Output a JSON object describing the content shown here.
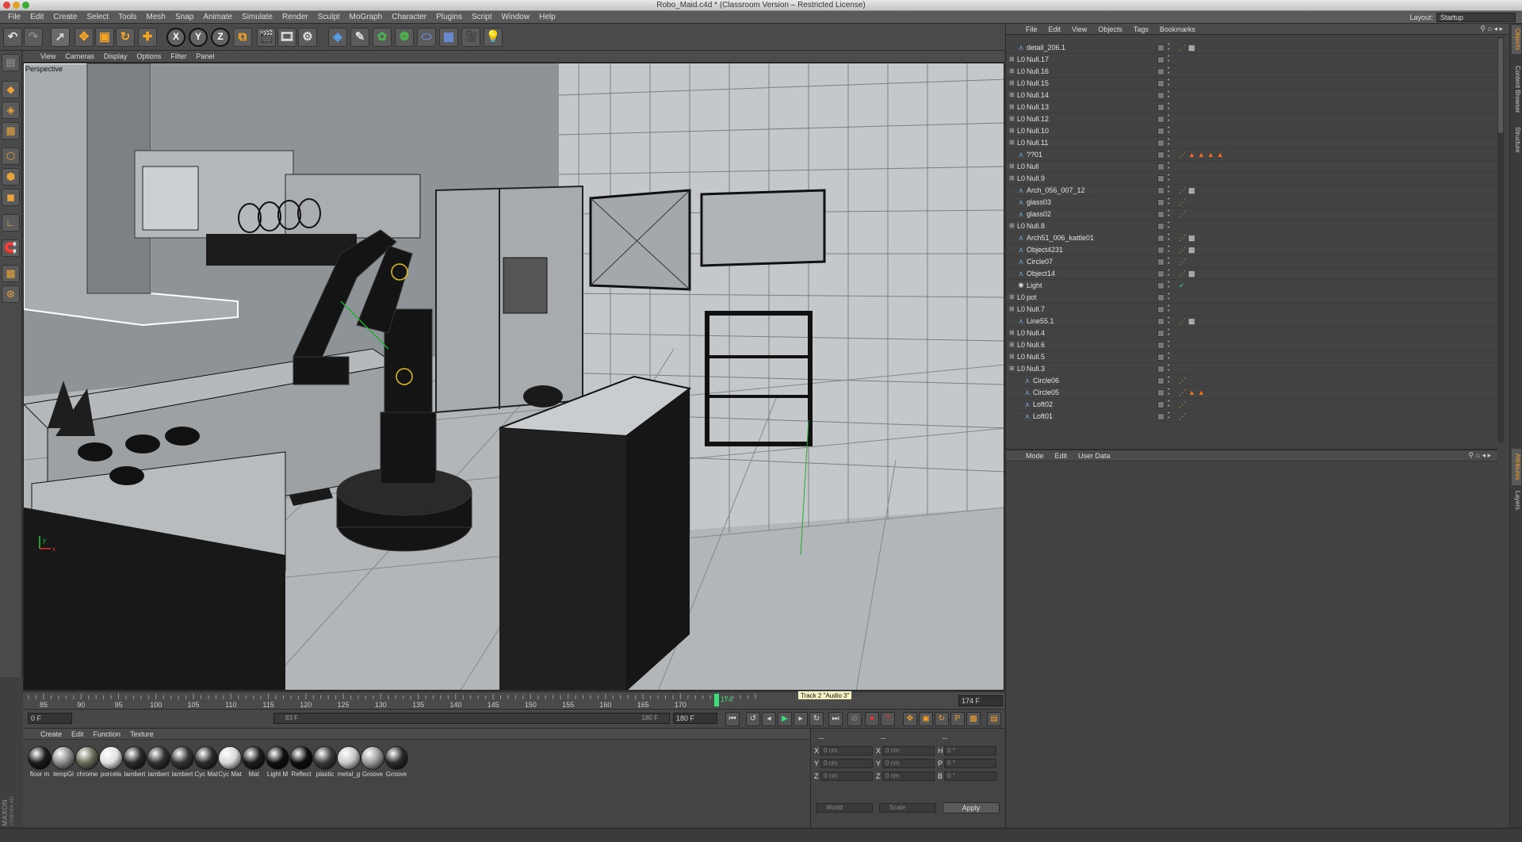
{
  "window": {
    "title": "Robo_Maid.c4d * (Classroom Version – Restricted License)"
  },
  "menubar": [
    "File",
    "Edit",
    "Create",
    "Select",
    "Tools",
    "Mesh",
    "Snap",
    "Animate",
    "Simulate",
    "Render",
    "Sculpt",
    "MoGraph",
    "Character",
    "Plugins",
    "Script",
    "Window",
    "Help"
  ],
  "layout": {
    "label": "Layout:",
    "value": "Startup"
  },
  "viewport": {
    "menu": [
      "View",
      "Cameras",
      "Display",
      "Options",
      "Filter",
      "Panel"
    ],
    "label": "Perspective"
  },
  "timeline": {
    "ticks": [
      "85",
      "90",
      "95",
      "100",
      "105",
      "110",
      "115",
      "120",
      "125",
      "130",
      "135",
      "140",
      "145",
      "150",
      "155",
      "160",
      "165",
      "170",
      "174"
    ],
    "current_frame": "174",
    "end_field": "174 F",
    "tooltip": "Track 2 \"Audio 3\""
  },
  "transport": {
    "start": "0 F",
    "range_start": "83 F",
    "range_end": "180 F",
    "end": "180 F"
  },
  "materials": {
    "menu": [
      "Create",
      "Edit",
      "Function",
      "Texture"
    ],
    "items": [
      {
        "label": "floor m",
        "color": "#1a1a1a"
      },
      {
        "label": "tempGl",
        "color": "#8a8a8a"
      },
      {
        "label": "chrome",
        "color": "#6b6b5a"
      },
      {
        "label": "porcela",
        "color": "#e0e0e0"
      },
      {
        "label": "lambert",
        "color": "#2a2a2a"
      },
      {
        "label": "lambert",
        "color": "#303030"
      },
      {
        "label": "lambert",
        "color": "#353535"
      },
      {
        "label": "Cyc Mat",
        "color": "#2c2c2c"
      },
      {
        "label": "Cyc Mat",
        "color": "#d8d8d8"
      },
      {
        "label": "Mat",
        "color": "#1c1c1c"
      },
      {
        "label": "Light M",
        "color": "#111111"
      },
      {
        "label": "Reflect",
        "color": "#0e0e0e"
      },
      {
        "label": "plastic",
        "color": "#3a3a3a"
      },
      {
        "label": "metal_g",
        "color": "#c8c8c8"
      },
      {
        "label": "Groove",
        "color": "#9a9a9a"
      },
      {
        "label": "Groove",
        "color": "#2a2a2a"
      }
    ]
  },
  "coords": {
    "headers": [
      "--",
      "--",
      "--"
    ],
    "rows": [
      {
        "a": "X",
        "av": "0 cm",
        "b": "X",
        "bv": "0 cm",
        "c": "H",
        "cv": "0 °"
      },
      {
        "a": "Y",
        "av": "0 cm",
        "b": "Y",
        "bv": "0 cm",
        "c": "P",
        "cv": "0 °"
      },
      {
        "a": "Z",
        "av": "0 cm",
        "b": "Z",
        "bv": "0 cm",
        "c": "B",
        "cv": "0 °"
      }
    ],
    "world": "World",
    "scale": "Scale",
    "apply": "Apply"
  },
  "brand": {
    "line1": "MAXON",
    "line2": "CINEMA 4D"
  },
  "objects": {
    "menu": [
      "File",
      "Edit",
      "View",
      "Objects",
      "Tags",
      "Bookmarks"
    ],
    "rows": [
      {
        "name": "detail_206.1",
        "type": "poly",
        "indent": 0,
        "tags": [
          "phong",
          "mat"
        ]
      },
      {
        "name": "Null.17",
        "type": "null",
        "indent": 0,
        "tags": []
      },
      {
        "name": "Null.16",
        "type": "null",
        "indent": 0,
        "tags": []
      },
      {
        "name": "Null.15",
        "type": "null",
        "indent": 0,
        "tags": []
      },
      {
        "name": "Null.14",
        "type": "null",
        "indent": 0,
        "tags": []
      },
      {
        "name": "Null.13",
        "type": "null",
        "indent": 0,
        "tags": []
      },
      {
        "name": "Null.12",
        "type": "null",
        "indent": 0,
        "tags": []
      },
      {
        "name": "Null.10",
        "type": "null",
        "indent": 0,
        "tags": []
      },
      {
        "name": "Null.11",
        "type": "null",
        "indent": 0,
        "tags": []
      },
      {
        "name": "??01",
        "type": "poly",
        "indent": 0,
        "tags": [
          "phong",
          "uvw",
          "uvw",
          "uvw",
          "uvw"
        ]
      },
      {
        "name": "Null",
        "type": "null",
        "indent": 0,
        "tags": []
      },
      {
        "name": "Null.9",
        "type": "null",
        "indent": 0,
        "tags": []
      },
      {
        "name": "Arch_056_007_12",
        "type": "poly",
        "indent": 0,
        "tags": [
          "phong",
          "mat"
        ]
      },
      {
        "name": "glass03",
        "type": "poly",
        "indent": 0,
        "tags": [
          "phong"
        ]
      },
      {
        "name": "glass02",
        "type": "poly",
        "indent": 0,
        "tags": [
          "phong"
        ]
      },
      {
        "name": "Null.8",
        "type": "null",
        "indent": 0,
        "tags": []
      },
      {
        "name": "Arch51_006_kattle01",
        "type": "poly",
        "indent": 0,
        "tags": [
          "phong",
          "mat"
        ]
      },
      {
        "name": "Object4231",
        "type": "poly",
        "indent": 0,
        "tags": [
          "phong",
          "mat"
        ]
      },
      {
        "name": "Circle07",
        "type": "poly",
        "indent": 0,
        "tags": [
          "phong"
        ]
      },
      {
        "name": "Object14",
        "type": "poly",
        "indent": 0,
        "tags": [
          "phong",
          "mat"
        ]
      },
      {
        "name": "Light",
        "type": "light",
        "indent": 0,
        "tags": [
          "check"
        ]
      },
      {
        "name": "pot",
        "type": "null",
        "indent": 0,
        "tags": []
      },
      {
        "name": "Null.7",
        "type": "null",
        "indent": 0,
        "tags": []
      },
      {
        "name": "Line55.1",
        "type": "poly",
        "indent": 0,
        "tags": [
          "phong",
          "mat"
        ]
      },
      {
        "name": "Null.4",
        "type": "null",
        "indent": 0,
        "tags": []
      },
      {
        "name": "Null.6",
        "type": "null",
        "indent": 0,
        "tags": []
      },
      {
        "name": "Null.5",
        "type": "null",
        "indent": 0,
        "tags": []
      },
      {
        "name": "Null.3",
        "type": "null",
        "indent": 0,
        "tags": []
      },
      {
        "name": "Circle06",
        "type": "poly",
        "indent": 1,
        "tags": [
          "phong"
        ]
      },
      {
        "name": "Circle05",
        "type": "poly",
        "indent": 1,
        "tags": [
          "phong",
          "uvw",
          "uvw"
        ]
      },
      {
        "name": "Loft02",
        "type": "poly",
        "indent": 1,
        "tags": [
          "phong"
        ]
      },
      {
        "name": "Loft01",
        "type": "poly",
        "indent": 1,
        "tags": [
          "phong"
        ]
      }
    ]
  },
  "attributes": {
    "menu": [
      "Mode",
      "Edit",
      "User Data"
    ]
  },
  "sidetabs": {
    "top": [
      "Objects",
      "Content Browser",
      "Structure"
    ],
    "bottom": [
      "Attributes",
      "Layers"
    ]
  }
}
